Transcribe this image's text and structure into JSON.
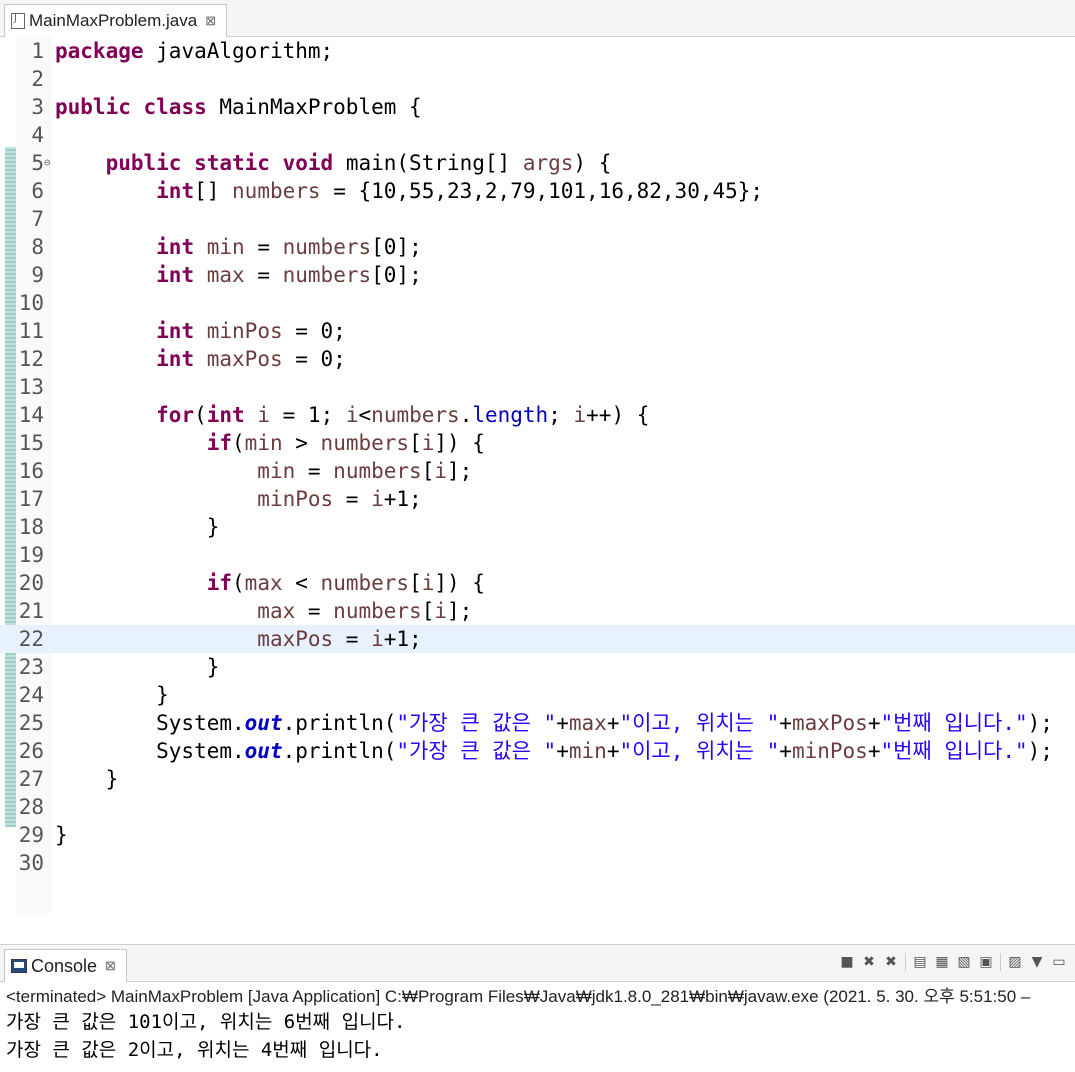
{
  "editor": {
    "tab_title": "MainMaxProblem.java",
    "tab_close": "⊠",
    "current_line": 22,
    "lines": [
      {
        "n": "1",
        "code": [
          {
            "t": "package",
            "c": "kw"
          },
          {
            "t": " javaAlgorithm;"
          }
        ]
      },
      {
        "n": "2",
        "code": []
      },
      {
        "n": "3",
        "code": [
          {
            "t": "public",
            "c": "kw"
          },
          {
            "t": " "
          },
          {
            "t": "class",
            "c": "kw"
          },
          {
            "t": " MainMaxProblem {"
          }
        ]
      },
      {
        "n": "4",
        "code": []
      },
      {
        "n": "5",
        "fold": "⊖",
        "code": [
          {
            "t": "    "
          },
          {
            "t": "public",
            "c": "kw"
          },
          {
            "t": " "
          },
          {
            "t": "static",
            "c": "kw"
          },
          {
            "t": " "
          },
          {
            "t": "void",
            "c": "kw"
          },
          {
            "t": " main(String[] "
          },
          {
            "t": "args",
            "c": "var"
          },
          {
            "t": ") {"
          }
        ]
      },
      {
        "n": "6",
        "code": [
          {
            "t": "        "
          },
          {
            "t": "int",
            "c": "kw"
          },
          {
            "t": "[] "
          },
          {
            "t": "numbers",
            "c": "var"
          },
          {
            "t": " = {10,55,23,2,79,101,16,82,30,45};"
          }
        ]
      },
      {
        "n": "7",
        "code": []
      },
      {
        "n": "8",
        "code": [
          {
            "t": "        "
          },
          {
            "t": "int",
            "c": "kw"
          },
          {
            "t": " "
          },
          {
            "t": "min",
            "c": "var"
          },
          {
            "t": " = "
          },
          {
            "t": "numbers",
            "c": "var"
          },
          {
            "t": "[0];"
          }
        ]
      },
      {
        "n": "9",
        "code": [
          {
            "t": "        "
          },
          {
            "t": "int",
            "c": "kw"
          },
          {
            "t": " "
          },
          {
            "t": "max",
            "c": "var"
          },
          {
            "t": " = "
          },
          {
            "t": "numbers",
            "c": "var"
          },
          {
            "t": "[0];"
          }
        ]
      },
      {
        "n": "10",
        "code": []
      },
      {
        "n": "11",
        "code": [
          {
            "t": "        "
          },
          {
            "t": "int",
            "c": "kw"
          },
          {
            "t": " "
          },
          {
            "t": "minPos",
            "c": "var"
          },
          {
            "t": " = 0;"
          }
        ]
      },
      {
        "n": "12",
        "code": [
          {
            "t": "        "
          },
          {
            "t": "int",
            "c": "kw"
          },
          {
            "t": " "
          },
          {
            "t": "maxPos",
            "c": "var"
          },
          {
            "t": " = 0;"
          }
        ]
      },
      {
        "n": "13",
        "code": []
      },
      {
        "n": "14",
        "code": [
          {
            "t": "        "
          },
          {
            "t": "for",
            "c": "kw"
          },
          {
            "t": "("
          },
          {
            "t": "int",
            "c": "kw"
          },
          {
            "t": " "
          },
          {
            "t": "i",
            "c": "var"
          },
          {
            "t": " = 1; "
          },
          {
            "t": "i",
            "c": "var"
          },
          {
            "t": "<"
          },
          {
            "t": "numbers",
            "c": "var"
          },
          {
            "t": "."
          },
          {
            "t": "length",
            "c": "fld"
          },
          {
            "t": "; "
          },
          {
            "t": "i",
            "c": "var"
          },
          {
            "t": "++) {"
          }
        ]
      },
      {
        "n": "15",
        "code": [
          {
            "t": "            "
          },
          {
            "t": "if",
            "c": "kw"
          },
          {
            "t": "("
          },
          {
            "t": "min",
            "c": "var"
          },
          {
            "t": " > "
          },
          {
            "t": "numbers",
            "c": "var"
          },
          {
            "t": "["
          },
          {
            "t": "i",
            "c": "var"
          },
          {
            "t": "]) {"
          }
        ]
      },
      {
        "n": "16",
        "code": [
          {
            "t": "                "
          },
          {
            "t": "min",
            "c": "var"
          },
          {
            "t": " = "
          },
          {
            "t": "numbers",
            "c": "var"
          },
          {
            "t": "["
          },
          {
            "t": "i",
            "c": "var"
          },
          {
            "t": "];"
          }
        ]
      },
      {
        "n": "17",
        "code": [
          {
            "t": "                "
          },
          {
            "t": "minPos",
            "c": "var"
          },
          {
            "t": " = "
          },
          {
            "t": "i",
            "c": "var"
          },
          {
            "t": "+1;"
          }
        ]
      },
      {
        "n": "18",
        "code": [
          {
            "t": "            }"
          }
        ]
      },
      {
        "n": "19",
        "code": []
      },
      {
        "n": "20",
        "code": [
          {
            "t": "            "
          },
          {
            "t": "if",
            "c": "kw"
          },
          {
            "t": "("
          },
          {
            "t": "max",
            "c": "var"
          },
          {
            "t": " < "
          },
          {
            "t": "numbers",
            "c": "var"
          },
          {
            "t": "["
          },
          {
            "t": "i",
            "c": "var"
          },
          {
            "t": "]) {"
          }
        ]
      },
      {
        "n": "21",
        "code": [
          {
            "t": "                "
          },
          {
            "t": "max",
            "c": "var"
          },
          {
            "t": " = "
          },
          {
            "t": "numbers",
            "c": "var"
          },
          {
            "t": "["
          },
          {
            "t": "i",
            "c": "var"
          },
          {
            "t": "];"
          }
        ]
      },
      {
        "n": "22",
        "code": [
          {
            "t": "                "
          },
          {
            "t": "maxPos",
            "c": "var"
          },
          {
            "t": " = "
          },
          {
            "t": "i",
            "c": "var"
          },
          {
            "t": "+1;"
          }
        ]
      },
      {
        "n": "23",
        "code": [
          {
            "t": "            }"
          }
        ]
      },
      {
        "n": "24",
        "code": [
          {
            "t": "        }"
          }
        ]
      },
      {
        "n": "25",
        "code": [
          {
            "t": "        System."
          },
          {
            "t": "out",
            "c": "sfld"
          },
          {
            "t": ".println("
          },
          {
            "t": "\"가장 큰 값은 \"",
            "c": "str"
          },
          {
            "t": "+"
          },
          {
            "t": "max",
            "c": "var"
          },
          {
            "t": "+"
          },
          {
            "t": "\"이고, 위치는 \"",
            "c": "str"
          },
          {
            "t": "+"
          },
          {
            "t": "maxPos",
            "c": "var"
          },
          {
            "t": "+"
          },
          {
            "t": "\"번째 입니다.\"",
            "c": "str"
          },
          {
            "t": ");"
          }
        ]
      },
      {
        "n": "26",
        "code": [
          {
            "t": "        System."
          },
          {
            "t": "out",
            "c": "sfld"
          },
          {
            "t": ".println("
          },
          {
            "t": "\"가장 큰 값은 \"",
            "c": "str"
          },
          {
            "t": "+"
          },
          {
            "t": "min",
            "c": "var"
          },
          {
            "t": "+"
          },
          {
            "t": "\"이고, 위치는 \"",
            "c": "str"
          },
          {
            "t": "+"
          },
          {
            "t": "minPos",
            "c": "var"
          },
          {
            "t": "+"
          },
          {
            "t": "\"번째 입니다.\"",
            "c": "str"
          },
          {
            "t": ");"
          }
        ]
      },
      {
        "n": "27",
        "code": [
          {
            "t": "    }"
          }
        ]
      },
      {
        "n": "28",
        "code": []
      },
      {
        "n": "29",
        "code": [
          {
            "t": "}"
          }
        ]
      },
      {
        "n": "30",
        "code": []
      }
    ]
  },
  "hscroll": {
    "left_arrow": "<"
  },
  "console": {
    "tab_title": "Console",
    "tab_close": "⊠",
    "toolbar": [
      "stop-icon",
      "remove-launch-icon",
      "remove-all-icon",
      "scroll-lock-icon",
      "word-wrap-icon",
      "pin-icon",
      "display-selected-icon",
      "open-console-icon",
      "view-menu-icon",
      "minimize-icon"
    ],
    "status": "<terminated> MainMaxProblem [Java Application] C:₩Program Files₩Java₩jdk1.8.0_281₩bin₩javaw.exe  (2021. 5. 30. 오후 5:51:50 –",
    "output": [
      "가장 큰 값은 101이고, 위치는 6번째 입니다.",
      "가장 큰 값은 2이고, 위치는 4번째 입니다."
    ]
  }
}
